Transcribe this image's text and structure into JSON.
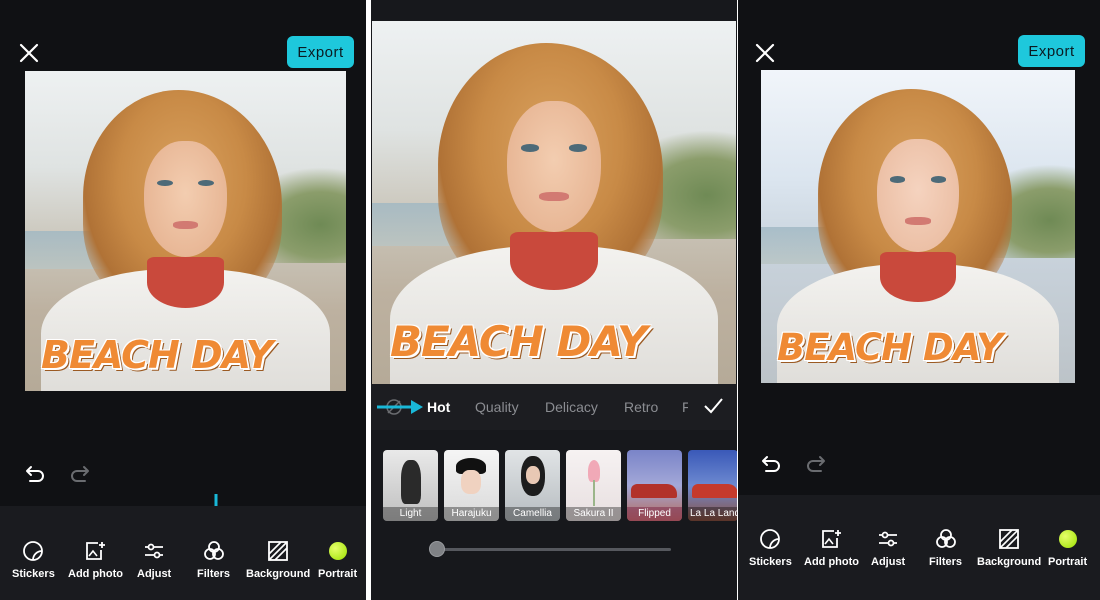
{
  "panels": [
    {
      "export_label": "Export",
      "headline": "BEACH DAY",
      "tools": [
        {
          "label": "Stickers",
          "icon": "sticker-icon"
        },
        {
          "label": "Add photo",
          "icon": "add-photo-icon"
        },
        {
          "label": "Adjust",
          "icon": "sliders-icon"
        },
        {
          "label": "Filters",
          "icon": "filters-icon"
        },
        {
          "label": "Background",
          "icon": "background-icon"
        },
        {
          "label": "Portrait",
          "icon": "portrait-dot-icon"
        }
      ]
    },
    {
      "headline": "BEACH DAY",
      "filter_tabs": [
        "Hot",
        "Quality",
        "Delicacy",
        "Retro",
        "F"
      ],
      "active_tab": "Hot",
      "filters": [
        "Light",
        "Harajuku",
        "Camellia",
        "Sakura II",
        "Flipped",
        "La La Land"
      ],
      "slider_value": 0
    },
    {
      "export_label": "Export",
      "headline": "BEACH DAY",
      "tools": [
        {
          "label": "Stickers",
          "icon": "sticker-icon"
        },
        {
          "label": "Add photo",
          "icon": "add-photo-icon"
        },
        {
          "label": "Adjust",
          "icon": "sliders-icon"
        },
        {
          "label": "Filters",
          "icon": "filters-icon"
        },
        {
          "label": "Background",
          "icon": "background-icon"
        },
        {
          "label": "Portrait",
          "icon": "portrait-dot-icon"
        }
      ]
    }
  ],
  "colors": {
    "accent": "#1ec8dc",
    "headline": "#ef8a34",
    "portrait_dot": "#b8f526"
  }
}
